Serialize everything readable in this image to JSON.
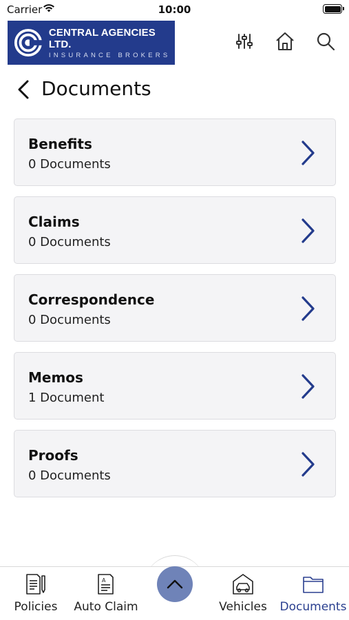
{
  "status_bar": {
    "carrier": "Carrier",
    "time": "10:00"
  },
  "header": {
    "logo_title": "CENTRAL AGENCIES LTD.",
    "logo_subtitle": "INSURANCE BROKERS",
    "icons": [
      "filter-sliders-icon",
      "home-icon",
      "search-icon"
    ]
  },
  "page": {
    "title": "Documents"
  },
  "documents": [
    {
      "name": "Benefits",
      "count": "0 Documents"
    },
    {
      "name": "Claims",
      "count": "0 Documents"
    },
    {
      "name": "Correspondence",
      "count": "0 Documents"
    },
    {
      "name": "Memos",
      "count": "1 Document"
    },
    {
      "name": "Proofs",
      "count": "0 Documents"
    }
  ],
  "tabs": [
    {
      "label": "Policies",
      "icon": "policy-document-icon",
      "active": false
    },
    {
      "label": "Auto Claim",
      "icon": "claim-form-icon",
      "active": false
    },
    {
      "label": "Vehicles",
      "icon": "garage-car-icon",
      "active": false
    },
    {
      "label": "Documents",
      "icon": "folder-icon",
      "active": true
    }
  ],
  "center_button": {
    "icon": "chevron-up-icon"
  },
  "colors": {
    "brand": "#233b8c",
    "accent": "#2a3f8f",
    "card_bg": "#f4f4f6",
    "center_button": "#6f83b8"
  }
}
